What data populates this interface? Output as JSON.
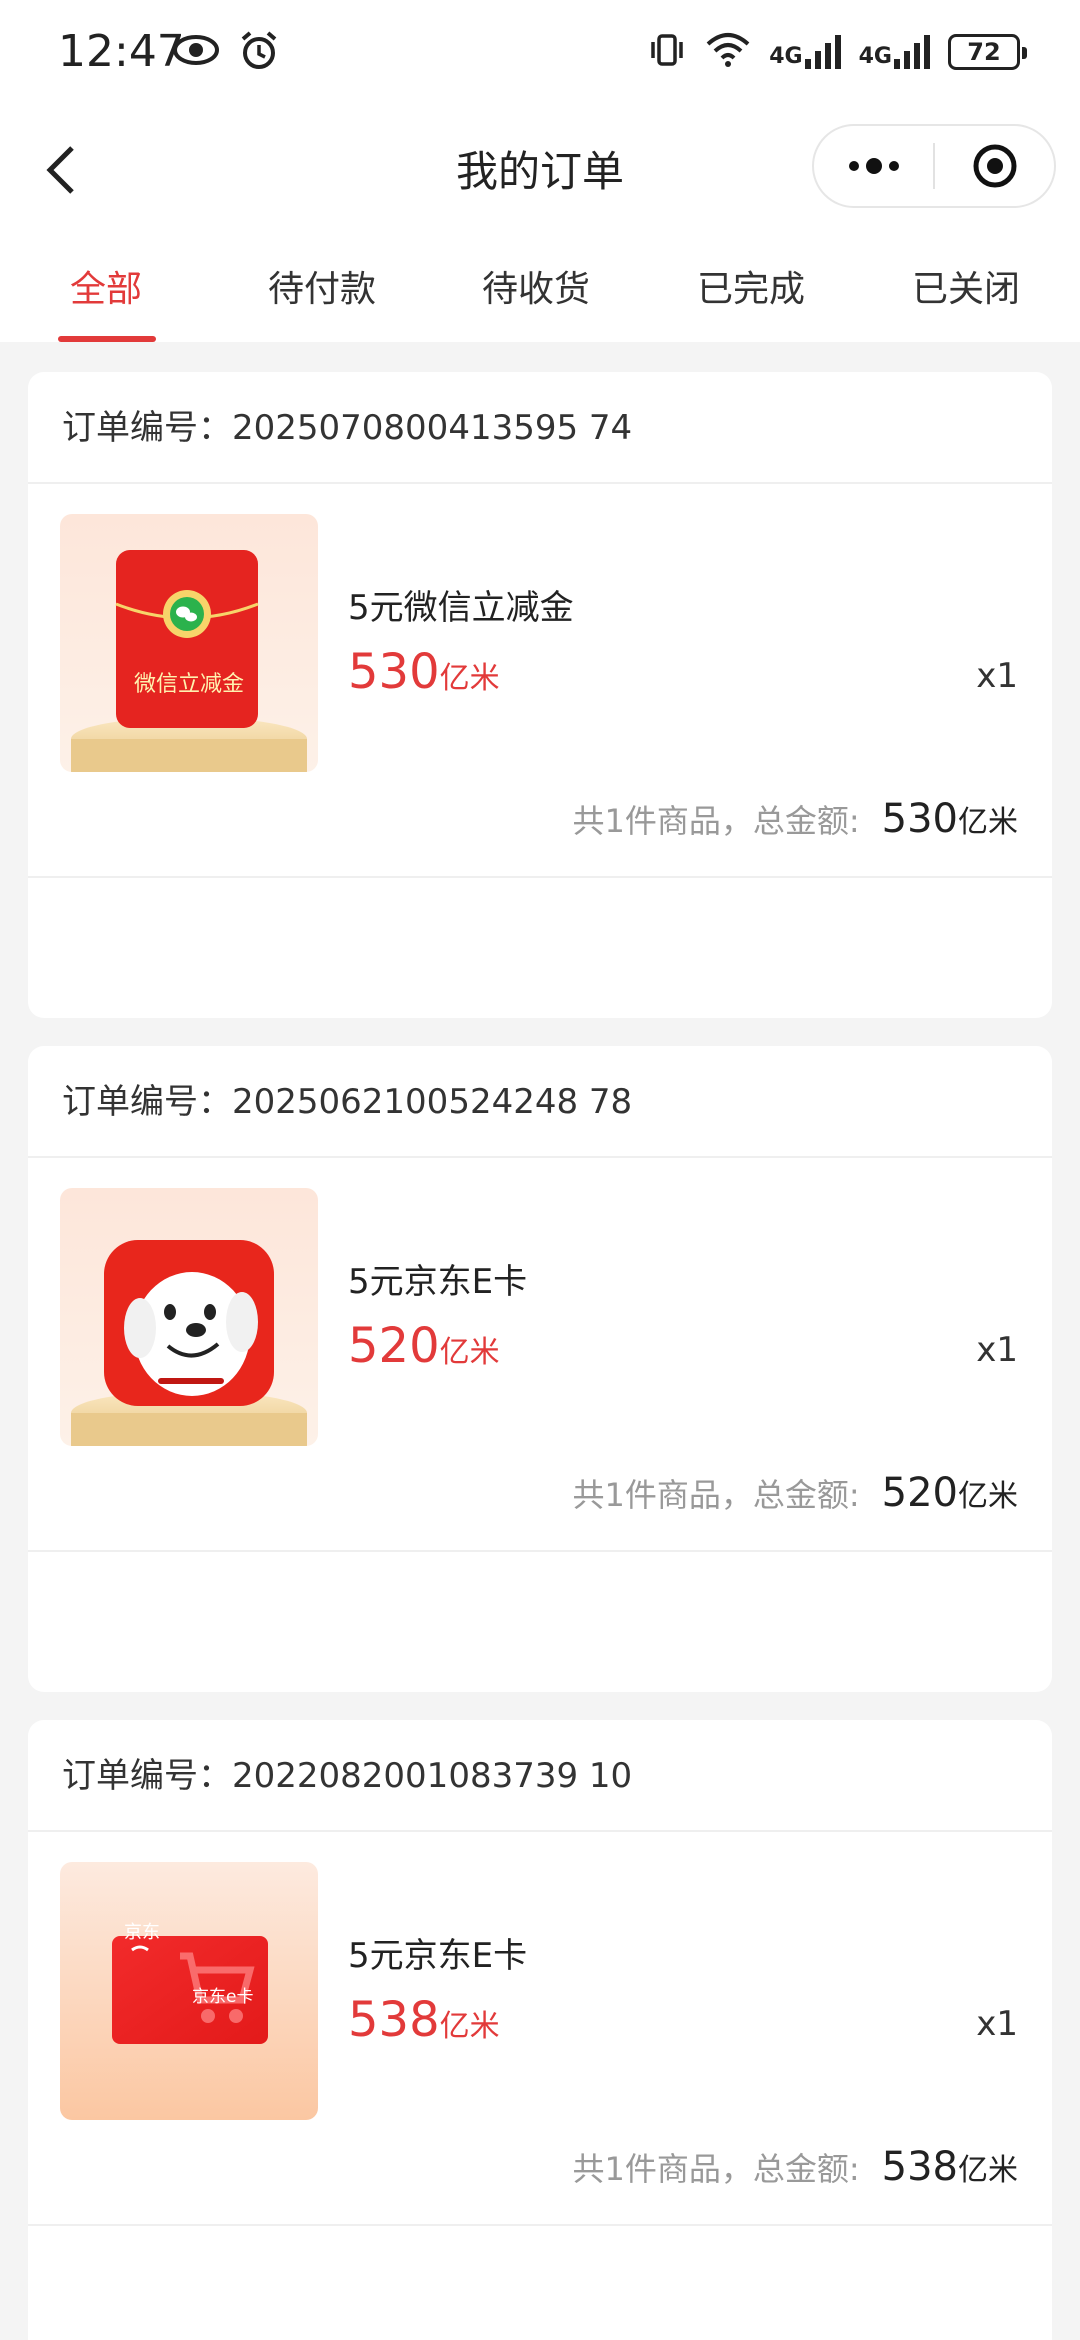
{
  "status_bar": {
    "time": "12:47",
    "network_1": "4G",
    "network_2": "4G",
    "battery": "72"
  },
  "nav": {
    "title": "我的订单"
  },
  "tabs": [
    {
      "label": "全部",
      "active": true
    },
    {
      "label": "待付款",
      "active": false
    },
    {
      "label": "待收货",
      "active": false
    },
    {
      "label": "已完成",
      "active": false
    },
    {
      "label": "已关闭",
      "active": false
    }
  ],
  "orders": [
    {
      "order_label": "订单编号：2025070800413595 74",
      "name": "5元微信立减金",
      "price": "530",
      "unit": "亿米",
      "qty": "x1",
      "total_label": "共1件商品，总金额:",
      "total": "530",
      "total_unit": "亿米",
      "thumb_text": "微信立减金"
    },
    {
      "order_label": "订单编号：2025062100524248 78",
      "name": "5元京东E卡",
      "price": "520",
      "unit": "亿米",
      "qty": "x1",
      "total_label": "共1件商品，总金额:",
      "total": "520",
      "total_unit": "亿米"
    },
    {
      "order_label": "订单编号：2022082001083739 10",
      "name": "5元京东E卡",
      "price": "538",
      "unit": "亿米",
      "qty": "x1",
      "total_label": "共1件商品，总金额:",
      "total": "538",
      "total_unit": "亿米",
      "thumb_text_top": "京东",
      "thumb_text_bottom": "京东e卡"
    }
  ],
  "colors": {
    "accent": "#e23a3a",
    "background": "#f4f4f4"
  }
}
